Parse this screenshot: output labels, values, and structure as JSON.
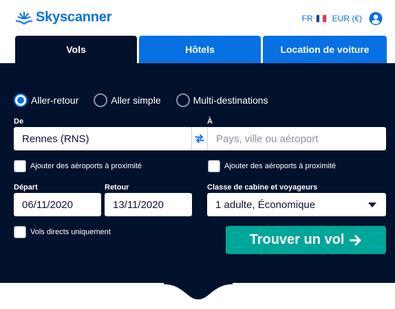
{
  "header": {
    "brand": "Skyscanner",
    "language": "FR",
    "currency": "EUR (€)",
    "brand_color": "#0770e3"
  },
  "tabs": [
    {
      "label": "Vols",
      "active": true
    },
    {
      "label": "Hôtels",
      "active": false
    },
    {
      "label": "Location de voiture",
      "active": false
    }
  ],
  "trip_type": {
    "options": [
      "Aller-retour",
      "Aller simple",
      "Multi-destinations"
    ],
    "selected": "Aller-retour"
  },
  "from": {
    "label": "De",
    "value": "Rennes (RNS)",
    "nearby_label": "Ajouter des aéroports à proximité"
  },
  "to": {
    "label": "À",
    "placeholder": "Pays, ville ou aéroport",
    "nearby_label": "Ajouter des aéroports à proximité"
  },
  "depart": {
    "label": "Départ",
    "value": "06/11/2020"
  },
  "return": {
    "label": "Retour",
    "value": "13/11/2020"
  },
  "cabin": {
    "label": "Classe de cabine et voyageurs",
    "value": "1 adulte, Économique"
  },
  "direct_only": {
    "label": "Vols directs uniquement",
    "checked": false
  },
  "search_button": {
    "label": "Trouver un vol",
    "icon": "arrow-right-icon",
    "color": "#00a698"
  },
  "panel_color": "#02122c"
}
